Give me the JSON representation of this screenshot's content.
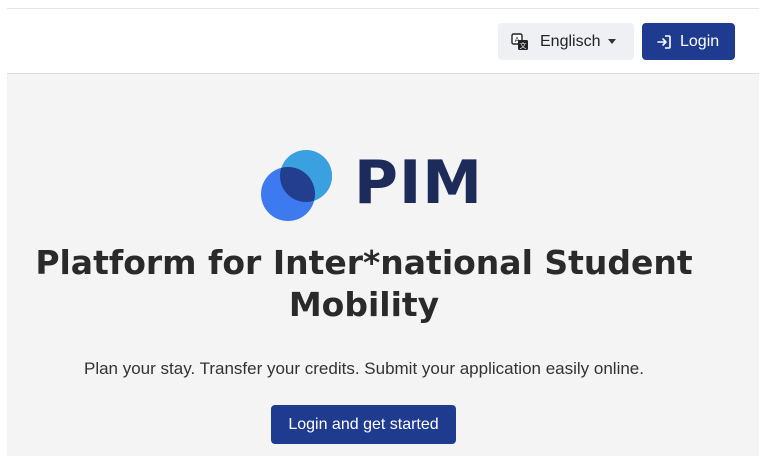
{
  "header": {
    "language_label": "Englisch",
    "language_icon": "translate-icon",
    "login_label": "Login",
    "login_icon": "sign-in-icon"
  },
  "hero": {
    "logo_text": "PIM",
    "headline": "Platform for Inter*national Student Mobility",
    "tagline": "Plan your stay. Transfer your credits. Submit your application easily online.",
    "cta_label": "Login and get started"
  },
  "colors": {
    "primary": "#1f3b8f",
    "logo_dark": "#1d2b5a",
    "logo_light_blue": "#3aa0e0",
    "logo_blue": "#2f6fe8",
    "content_bg": "#f4f4f4"
  }
}
